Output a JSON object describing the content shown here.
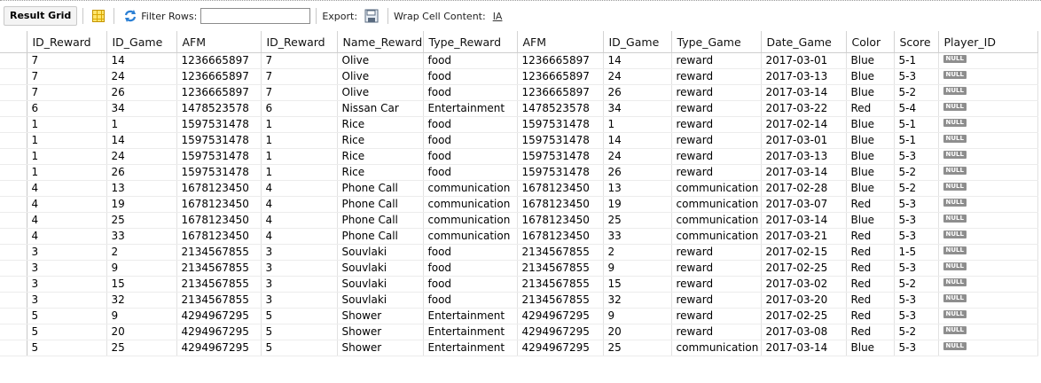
{
  "toolbar": {
    "result_grid_label": "Result Grid",
    "filter_rows_label": "Filter Rows:",
    "filter_value": "",
    "export_label": "Export:",
    "wrap_label": "Wrap Cell Content:",
    "wrap_icon_glyph": "IA"
  },
  "columns": [
    "ID_Reward",
    "ID_Game",
    "AFM",
    "ID_Reward",
    "Name_Reward",
    "Type_Reward",
    "AFM",
    "ID_Game",
    "Type_Game",
    "Date_Game",
    "Color",
    "Score",
    "Player_ID"
  ],
  "null_label": "NULL",
  "rows": [
    [
      "7",
      "14",
      "1236665897",
      "7",
      "Olive",
      "food",
      "1236665897",
      "14",
      "reward",
      "2017-03-01",
      "Blue",
      "5-1"
    ],
    [
      "7",
      "24",
      "1236665897",
      "7",
      "Olive",
      "food",
      "1236665897",
      "24",
      "reward",
      "2017-03-13",
      "Blue",
      "5-3"
    ],
    [
      "7",
      "26",
      "1236665897",
      "7",
      "Olive",
      "food",
      "1236665897",
      "26",
      "reward",
      "2017-03-14",
      "Blue",
      "5-2"
    ],
    [
      "6",
      "34",
      "1478523578",
      "6",
      "Nissan Car",
      "Entertainment",
      "1478523578",
      "34",
      "reward",
      "2017-03-22",
      "Red",
      "5-4"
    ],
    [
      "1",
      "1",
      "1597531478",
      "1",
      "Rice",
      "food",
      "1597531478",
      "1",
      "reward",
      "2017-02-14",
      "Blue",
      "5-1"
    ],
    [
      "1",
      "14",
      "1597531478",
      "1",
      "Rice",
      "food",
      "1597531478",
      "14",
      "reward",
      "2017-03-01",
      "Blue",
      "5-1"
    ],
    [
      "1",
      "24",
      "1597531478",
      "1",
      "Rice",
      "food",
      "1597531478",
      "24",
      "reward",
      "2017-03-13",
      "Blue",
      "5-3"
    ],
    [
      "1",
      "26",
      "1597531478",
      "1",
      "Rice",
      "food",
      "1597531478",
      "26",
      "reward",
      "2017-03-14",
      "Blue",
      "5-2"
    ],
    [
      "4",
      "13",
      "1678123450",
      "4",
      "Phone Call",
      "communication",
      "1678123450",
      "13",
      "communication",
      "2017-02-28",
      "Blue",
      "5-2"
    ],
    [
      "4",
      "19",
      "1678123450",
      "4",
      "Phone Call",
      "communication",
      "1678123450",
      "19",
      "communication",
      "2017-03-07",
      "Red",
      "5-3"
    ],
    [
      "4",
      "25",
      "1678123450",
      "4",
      "Phone Call",
      "communication",
      "1678123450",
      "25",
      "communication",
      "2017-03-14",
      "Blue",
      "5-3"
    ],
    [
      "4",
      "33",
      "1678123450",
      "4",
      "Phone Call",
      "communication",
      "1678123450",
      "33",
      "communication",
      "2017-03-21",
      "Red",
      "5-3"
    ],
    [
      "3",
      "2",
      "2134567855",
      "3",
      "Souvlaki",
      "food",
      "2134567855",
      "2",
      "reward",
      "2017-02-15",
      "Red",
      "1-5"
    ],
    [
      "3",
      "9",
      "2134567855",
      "3",
      "Souvlaki",
      "food",
      "2134567855",
      "9",
      "reward",
      "2017-02-25",
      "Red",
      "5-3"
    ],
    [
      "3",
      "15",
      "2134567855",
      "3",
      "Souvlaki",
      "food",
      "2134567855",
      "15",
      "reward",
      "2017-03-02",
      "Red",
      "5-2"
    ],
    [
      "3",
      "32",
      "2134567855",
      "3",
      "Souvlaki",
      "food",
      "2134567855",
      "32",
      "reward",
      "2017-03-20",
      "Red",
      "5-3"
    ],
    [
      "5",
      "9",
      "4294967295",
      "5",
      "Shower",
      "Entertainment",
      "4294967295",
      "9",
      "reward",
      "2017-02-25",
      "Red",
      "5-3"
    ],
    [
      "5",
      "20",
      "4294967295",
      "5",
      "Shower",
      "Entertainment",
      "4294967295",
      "20",
      "reward",
      "2017-03-08",
      "Red",
      "5-2"
    ],
    [
      "5",
      "25",
      "4294967295",
      "5",
      "Shower",
      "Entertainment",
      "4294967295",
      "25",
      "communication",
      "2017-03-14",
      "Blue",
      "5-3"
    ]
  ],
  "colors": {
    "null_badge": "#8e8e8e",
    "grid_icon": "#ffe46b",
    "refresh_icon": "#2a7fd4"
  }
}
